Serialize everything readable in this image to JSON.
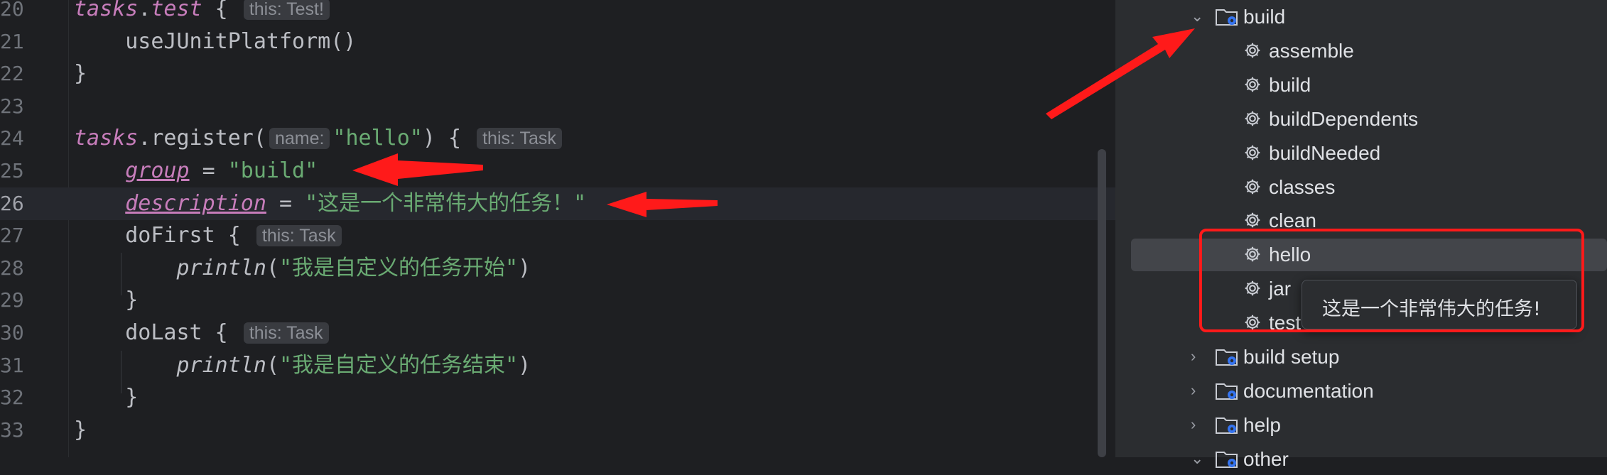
{
  "editor": {
    "lines": [
      {
        "num": "20",
        "tokens": [
          {
            "t": "tasks",
            "c": "kw-ital"
          },
          {
            "t": ".",
            "c": ""
          },
          {
            "t": "test",
            "c": "kw-ital"
          },
          {
            "t": " { ",
            "c": ""
          },
          {
            "t": "this: Test!",
            "c": "hint"
          }
        ]
      },
      {
        "num": "21",
        "tokens": [
          {
            "t": "    useJUnitPlatform()",
            "c": ""
          }
        ]
      },
      {
        "num": "22",
        "tokens": [
          {
            "t": "}",
            "c": ""
          }
        ]
      },
      {
        "num": "23",
        "tokens": []
      },
      {
        "num": "24",
        "tokens": [
          {
            "t": "tasks",
            "c": "kw-ital"
          },
          {
            "t": ".register(",
            "c": ""
          },
          {
            "t": "name:",
            "c": "hint"
          },
          {
            "t": "\"hello\"",
            "c": "str"
          },
          {
            "t": ") { ",
            "c": ""
          },
          {
            "t": "this: Task",
            "c": "hint"
          }
        ]
      },
      {
        "num": "25",
        "tokens": [
          {
            "t": "    ",
            "c": ""
          },
          {
            "t": "group",
            "c": "kw-prop"
          },
          {
            "t": " = ",
            "c": ""
          },
          {
            "t": "\"build\"",
            "c": "str"
          }
        ]
      },
      {
        "num": "26",
        "tokens": [
          {
            "t": "    ",
            "c": ""
          },
          {
            "t": "description",
            "c": "kw-prop"
          },
          {
            "t": " = ",
            "c": ""
          },
          {
            "t": "\"这是一个非常伟大的任务！\"",
            "c": "str"
          }
        ],
        "current": true
      },
      {
        "num": "27",
        "tokens": [
          {
            "t": "    doFirst { ",
            "c": ""
          },
          {
            "t": "this: Task",
            "c": "hint"
          }
        ]
      },
      {
        "num": "28",
        "tokens": [
          {
            "t": "        ",
            "c": ""
          },
          {
            "t": "println",
            "c": "fn-ital"
          },
          {
            "t": "(",
            "c": ""
          },
          {
            "t": "\"我是自定义的任务开始\"",
            "c": "str"
          },
          {
            "t": ")",
            "c": ""
          }
        ]
      },
      {
        "num": "29",
        "tokens": [
          {
            "t": "    }",
            "c": ""
          }
        ]
      },
      {
        "num": "30",
        "tokens": [
          {
            "t": "    doLast { ",
            "c": ""
          },
          {
            "t": "this: Task",
            "c": "hint"
          }
        ]
      },
      {
        "num": "31",
        "tokens": [
          {
            "t": "        ",
            "c": ""
          },
          {
            "t": "println",
            "c": "fn-ital"
          },
          {
            "t": "(",
            "c": ""
          },
          {
            "t": "\"我是自定义的任务结束\"",
            "c": "str"
          },
          {
            "t": ")",
            "c": ""
          }
        ]
      },
      {
        "num": "32",
        "tokens": [
          {
            "t": "    }",
            "c": ""
          }
        ]
      },
      {
        "num": "33",
        "tokens": [
          {
            "t": "}",
            "c": ""
          }
        ]
      }
    ]
  },
  "gradle_tree": {
    "build_group": {
      "label": "build",
      "expanded": true
    },
    "tasks": [
      "assemble",
      "build",
      "buildDependents",
      "buildNeeded",
      "classes",
      "clean",
      "hello",
      "jar",
      "test"
    ],
    "selected_task": "hello",
    "groups": [
      {
        "label": "build setup",
        "expanded": false
      },
      {
        "label": "documentation",
        "expanded": false
      },
      {
        "label": "help",
        "expanded": false
      },
      {
        "label": "other",
        "expanded": true
      }
    ]
  },
  "tooltip": {
    "text": "这是一个非常伟大的任务!"
  },
  "icons": {
    "expanded": "chevron-down-icon",
    "collapsed": "chevron-right-icon",
    "task": "gear-icon",
    "group": "gradle-folder-icon"
  },
  "colors": {
    "annotation_red": "#ff1a1a",
    "string_green": "#6aab73",
    "keyword_purple": "#c77dbb"
  }
}
